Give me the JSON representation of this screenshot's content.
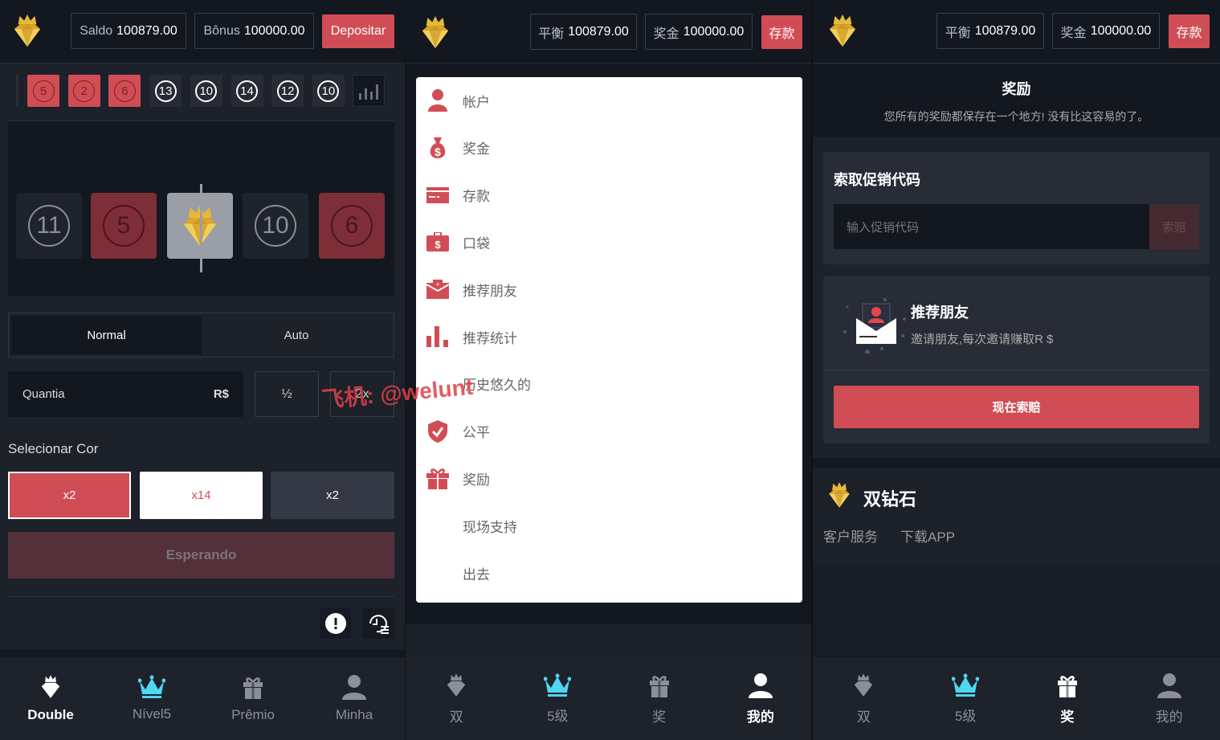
{
  "colors": {
    "accent": "#d14d55",
    "header_bg": "#131720",
    "panel_bg": "#1d212a",
    "nav_active_icon": "#4fd6f0"
  },
  "panel1": {
    "header": {
      "balance_label": "Saldo",
      "balance_value": "100879.00",
      "bonus_label": "Bônus",
      "bonus_value": "100000.00",
      "deposit_button": "Depositar"
    },
    "history": [
      {
        "n": "5",
        "color": "red"
      },
      {
        "n": "2",
        "color": "red"
      },
      {
        "n": "6",
        "color": "red"
      },
      {
        "n": "13",
        "color": "black"
      },
      {
        "n": "10",
        "color": "black"
      },
      {
        "n": "14",
        "color": "black"
      },
      {
        "n": "12",
        "color": "black"
      },
      {
        "n": "10",
        "color": "black"
      }
    ],
    "history_icon": "bar-chart-icon",
    "roulette": [
      {
        "n": "11",
        "color": "black"
      },
      {
        "n": "5",
        "color": "red"
      },
      {
        "n": "",
        "color": "white"
      },
      {
        "n": "10",
        "color": "black"
      },
      {
        "n": "6",
        "color": "red"
      }
    ],
    "modes": {
      "normal": "Normal",
      "auto": "Auto",
      "selected": "Normal"
    },
    "amount": {
      "label": "Quantia",
      "currency": "R$",
      "half": "½",
      "double": "2x"
    },
    "select_color_label": "Selecionar Cor",
    "colors": [
      {
        "label": "x2",
        "color": "red",
        "selected": true
      },
      {
        "label": "x14",
        "color": "white"
      },
      {
        "label": "x2",
        "color": "black"
      }
    ],
    "waiting_button": "Esperando",
    "nav": [
      {
        "label": "Double",
        "icon": "diamond-crown-icon",
        "active": true
      },
      {
        "label": "Nível5",
        "icon": "crown-icon"
      },
      {
        "label": "Prêmio",
        "icon": "gift-icon"
      },
      {
        "label": "Minha",
        "icon": "user-icon"
      }
    ]
  },
  "panel2": {
    "header": {
      "balance_label": "平衡",
      "balance_value": "100879.00",
      "bonus_label": "奖金",
      "bonus_value": "100000.00",
      "deposit_button": "存款"
    },
    "menu": [
      {
        "label": "帐户",
        "icon": "user-icon"
      },
      {
        "label": "奖金",
        "icon": "money-bag-icon"
      },
      {
        "label": "存款",
        "icon": "credit-card-icon"
      },
      {
        "label": "口袋",
        "icon": "wallet-icon"
      },
      {
        "label": "推荐朋友",
        "icon": "envelope-icon"
      },
      {
        "label": "推荐统计",
        "icon": "bar-chart-icon"
      },
      {
        "label": "历史悠久的",
        "icon": ""
      },
      {
        "label": "公平",
        "icon": "shield-check-icon"
      },
      {
        "label": "奖励",
        "icon": "gift-icon"
      },
      {
        "label": "现场支持",
        "icon": ""
      },
      {
        "label": "出去",
        "icon": ""
      }
    ],
    "nav": [
      {
        "label": "双",
        "icon": "diamond-crown-icon"
      },
      {
        "label": "5级",
        "icon": "crown-icon"
      },
      {
        "label": "奖",
        "icon": "gift-icon"
      },
      {
        "label": "我的",
        "icon": "user-icon",
        "active": true
      }
    ]
  },
  "panel3": {
    "header": {
      "balance_label": "平衡",
      "balance_value": "100879.00",
      "bonus_label": "奖金",
      "bonus_value": "100000.00",
      "deposit_button": "存款"
    },
    "title": "奖励",
    "subtitle": "您所有的奖励都保存在一个地方! 没有比这容易的了。",
    "promo": {
      "title": "索取促销代码",
      "placeholder": "输入促销代码",
      "button": "索赔"
    },
    "referral": {
      "title": "推荐朋友",
      "subtitle": "邀请朋友,每次邀请赚取R $",
      "button": "现在索赔"
    },
    "footer": {
      "brand": "双钻石",
      "links": [
        "客户服务",
        "下载APP"
      ]
    },
    "nav": [
      {
        "label": "双",
        "icon": "diamond-crown-icon"
      },
      {
        "label": "5级",
        "icon": "crown-icon"
      },
      {
        "label": "奖",
        "icon": "gift-icon",
        "active": true
      },
      {
        "label": "我的",
        "icon": "user-icon"
      }
    ]
  },
  "watermark": "飞机: @welunt"
}
